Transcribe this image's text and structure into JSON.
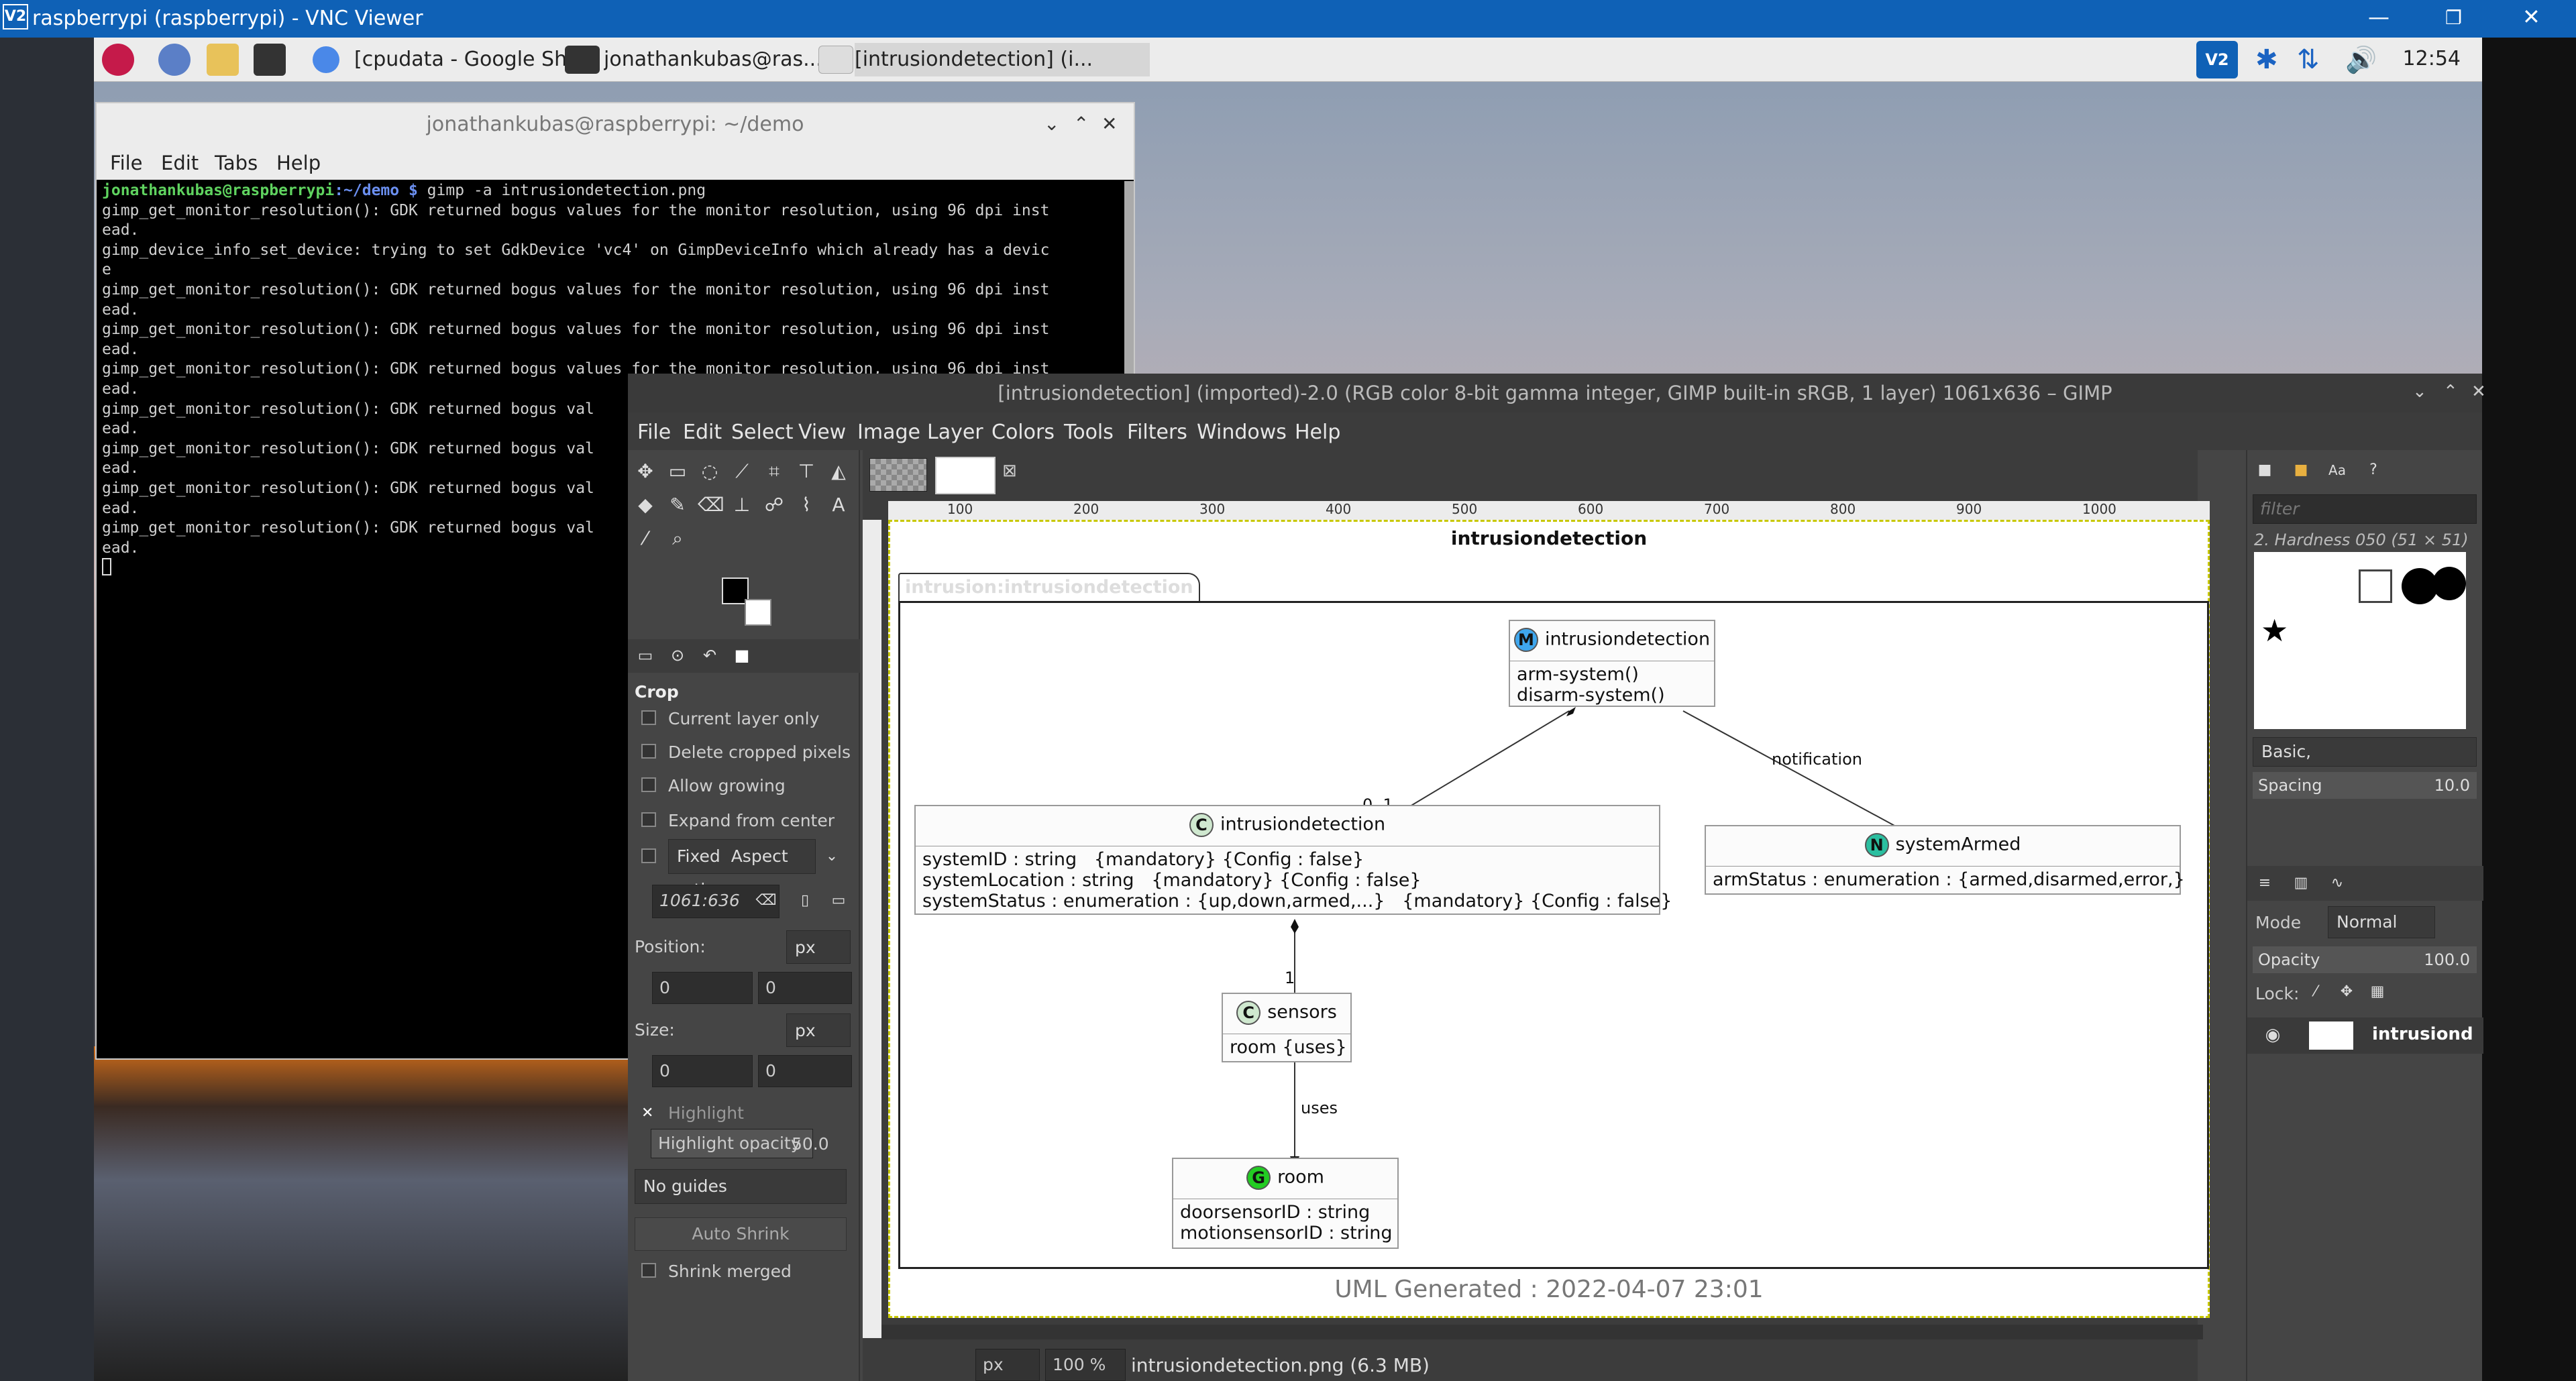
{
  "vnc": {
    "title": "raspberrypi (raspberrypi) - VNC Viewer",
    "logo": "V2"
  },
  "taskbar": {
    "items": [
      "[cpudata - Google Sh...",
      "jonathankubas@ras...",
      "[intrusiondetection] (i..."
    ],
    "clock": "12:54"
  },
  "terminal": {
    "title": "jonathankubas@raspberrypi: ~/demo",
    "menu": [
      "File",
      "Edit",
      "Tabs",
      "Help"
    ],
    "prompt": "jonathankubas@raspberrypi",
    "cwd": ":~/demo $",
    "command": " gimp -a intrusiondetection.png",
    "lines": [
      "gimp_get_monitor_resolution(): GDK returned bogus values for the monitor resolution, using 96 dpi inst",
      "ead.",
      "gimp_device_info_set_device: trying to set GdkDevice 'vc4' on GimpDeviceInfo which already has a devic",
      "e",
      "gimp_get_monitor_resolution(): GDK returned bogus values for the monitor resolution, using 96 dpi inst",
      "ead.",
      "gimp_get_monitor_resolution(): GDK returned bogus values for the monitor resolution, using 96 dpi inst",
      "ead.",
      "gimp_get_monitor_resolution(): GDK returned bogus values for the monitor resolution, using 96 dpi inst",
      "ead.",
      "gimp_get_monitor_resolution(): GDK returned bogus val",
      "ead.",
      "gimp_get_monitor_resolution(): GDK returned bogus val",
      "ead.",
      "gimp_get_monitor_resolution(): GDK returned bogus val",
      "ead.",
      "gimp_get_monitor_resolution(): GDK returned bogus val",
      "ead."
    ]
  },
  "gimp": {
    "title": "[intrusiondetection] (imported)-2.0 (RGB color 8-bit gamma integer, GIMP built-in sRGB, 1 layer) 1061x636 – GIMP",
    "menu": [
      "File",
      "Edit",
      "Select",
      "View",
      "Image",
      "Layer",
      "Colors",
      "Tools",
      "Filters",
      "Windows",
      "Help"
    ],
    "crop": {
      "heading": "Crop",
      "options": [
        "Current layer only",
        "Delete cropped pixels",
        "Allow growing",
        "Expand from center"
      ],
      "fixed_label": "Fixed",
      "aspect": "Aspect ratio",
      "ratio_value": "1061:636",
      "position_label": "Position:",
      "unit": "px",
      "pos_x": "0",
      "pos_y": "0",
      "size_label": "Size:",
      "size_x": "0",
      "size_y": "0",
      "highlight": "Highlight",
      "highlight_opacity_label": "Highlight opacity",
      "highlight_opacity_value": "50.0",
      "guides": "No guides",
      "auto_shrink": "Auto Shrink",
      "shrink_merged": "Shrink merged"
    },
    "ruler": [
      "100",
      "200",
      "300",
      "400",
      "500",
      "600",
      "700",
      "800",
      "900",
      "1000"
    ],
    "status": {
      "unit": "px",
      "zoom": "100 %",
      "file": "intrusiondetection.png (6.3 MB)"
    },
    "brushes": {
      "filter_placeholder": "filter",
      "brush_name": "2. Hardness 050 (51 × 51)",
      "preset": "Basic,",
      "spacing_label": "Spacing",
      "spacing_value": "10.0"
    },
    "layers": {
      "mode_label": "Mode",
      "mode_value": "Normal",
      "opacity_label": "Opacity",
      "opacity_value": "100.0",
      "lock_label": "Lock:",
      "layer_name": "intrusiond"
    }
  },
  "uml": {
    "title": "intrusiondetection",
    "package": "intrusion:intrusiondetection",
    "module": {
      "badge": "M",
      "name": "intrusiondetection",
      "ops": [
        "arm-system()",
        "disarm-system()"
      ]
    },
    "cls_main": {
      "badge": "C",
      "name": "intrusiondetection",
      "attrs": [
        "systemID : string   {mandatory} {Config : false}",
        "systemLocation : string   {mandatory} {Config : false}",
        "systemStatus : enumeration : {up,down,armed,...}   {mandatory} {Config : false}"
      ]
    },
    "notif": {
      "badge": "N",
      "name": "systemArmed",
      "attrs": [
        "armStatus : enumeration : {armed,disarmed,error,}"
      ]
    },
    "sensors": {
      "badge": "C",
      "name": "sensors",
      "attrs": [
        "room {uses}"
      ]
    },
    "room": {
      "badge": "G",
      "name": "room",
      "attrs": [
        "doorsensorID : string",
        "motionsensorID : string"
      ]
    },
    "labels": {
      "mult_01": "0..1",
      "notification": "notification",
      "mult_1": "1",
      "uses": "uses"
    },
    "footer": "UML Generated : 2022-04-07 23:01"
  }
}
